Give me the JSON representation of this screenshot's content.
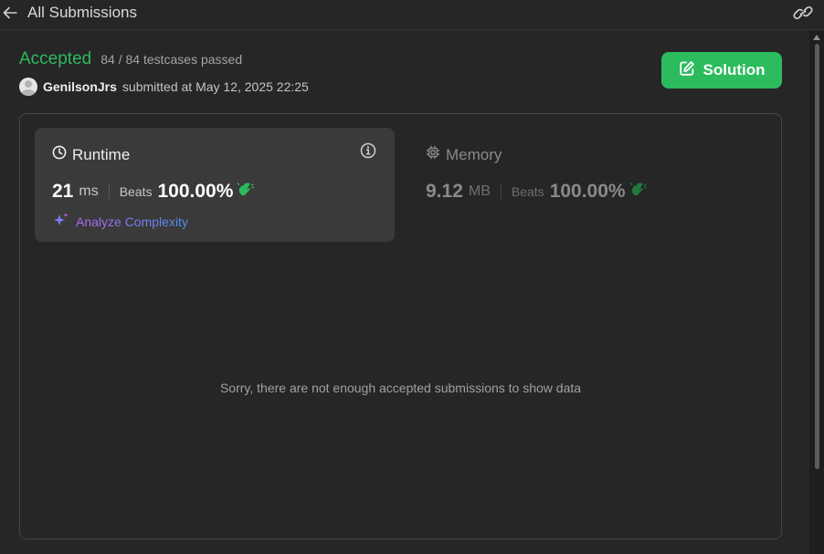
{
  "topbar": {
    "back_label": "All Submissions",
    "back_icon": "arrow-left-icon",
    "share_icon": "link-icon"
  },
  "submission": {
    "status": "Accepted",
    "testcases": "84 / 84 testcases passed",
    "username": "GenilsonJrs",
    "submitted_text": "submitted at May 12, 2025 22:25",
    "solution_label": "Solution"
  },
  "runtime": {
    "title": "Runtime",
    "value": "21",
    "unit": "ms",
    "beats_label": "Beats",
    "beats_value": "100.00%",
    "analyze_label": "Analyze Complexity"
  },
  "memory": {
    "title": "Memory",
    "value": "9.12",
    "unit": "MB",
    "beats_label": "Beats",
    "beats_value": "100.00%"
  },
  "empty_message": "Sorry, there are not enough accepted submissions to show data",
  "colors": {
    "accent_green": "#2cbb5d",
    "background": "#262626",
    "card": "#3a3a3a"
  }
}
